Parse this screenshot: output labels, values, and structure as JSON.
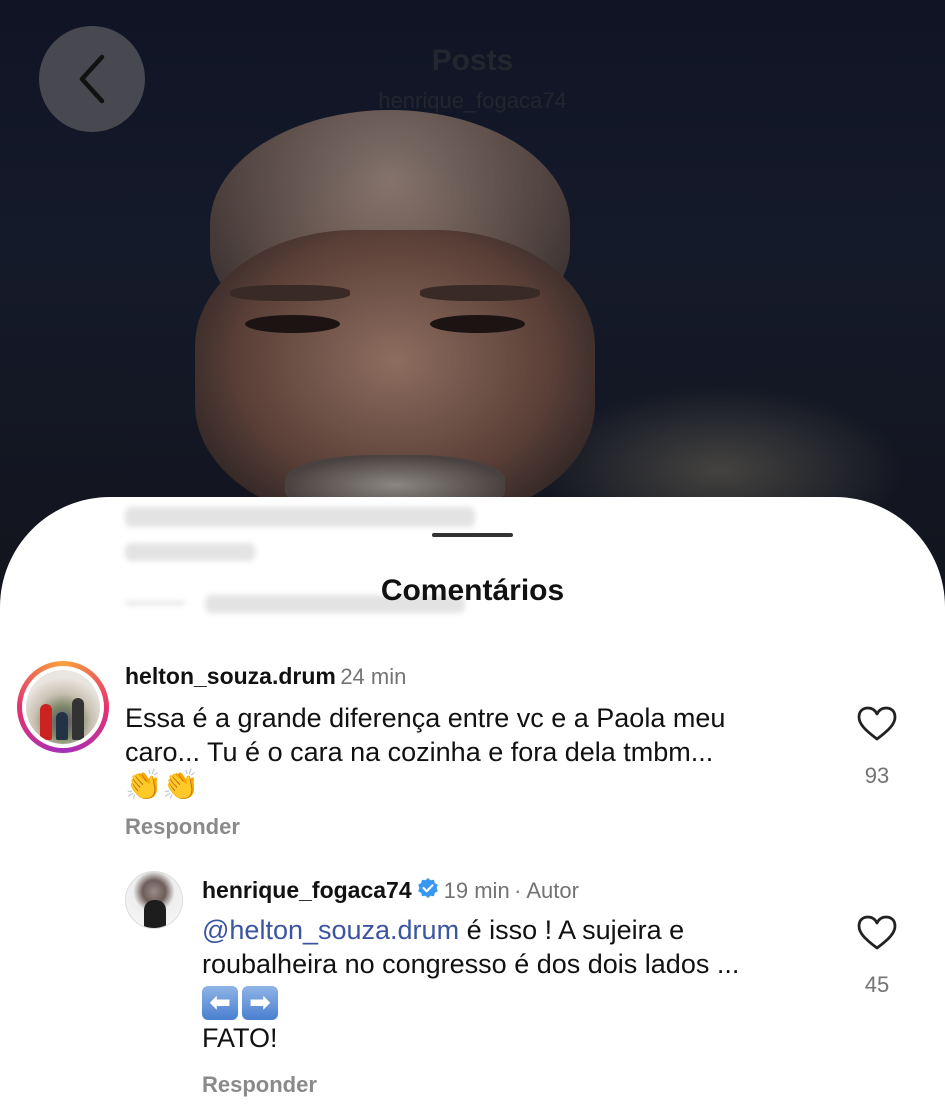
{
  "header": {
    "title": "Posts",
    "subtitle": "henrique_fogaca74"
  },
  "sheet": {
    "title": "Comentários"
  },
  "comments": [
    {
      "username": "helton_souza.drum",
      "time": "24 min",
      "text_line1": "Essa é a grande diferença entre vc e a Paola meu",
      "text_line2": "caro... Tu é o cara na cozinha e fora dela tmbm...",
      "emoji": "👏👏",
      "reply_label": "Responder",
      "likes": "93"
    },
    {
      "username": "henrique_fogaca74",
      "time": "19 min",
      "author_tag": "· Autor",
      "mention": "@helton_souza.drum",
      "text_line1_rest": " é isso ! A sujeira e",
      "text_line2": "roubalheira no congresso é dos dois lados ...",
      "arrow_left": "⬅",
      "arrow_right": "➡",
      "text_line4": "FATO!",
      "reply_label": "Responder",
      "likes": "45"
    }
  ],
  "colors": {
    "mention": "#3b55a0",
    "verified": "#3897f0"
  },
  "icons": {
    "back": "chevron-left-icon",
    "like": "heart-icon",
    "verified": "verified-badge-icon"
  }
}
